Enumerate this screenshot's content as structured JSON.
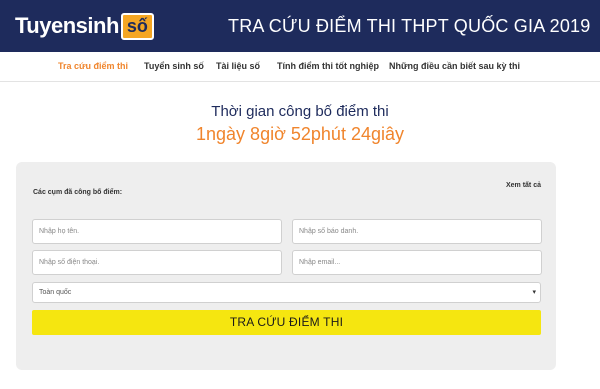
{
  "header": {
    "logo_text": "Tuyensinh",
    "logo_badge": "số",
    "title": "TRA CỨU ĐIỂM THI THPT QUỐC GIA 2019"
  },
  "nav": {
    "items": [
      {
        "label": "Tra cứu điểm thi",
        "active": true
      },
      {
        "label": "Tuyển sinh số",
        "active": false
      },
      {
        "label": "Tài liệu số",
        "active": false
      },
      {
        "label": "Tính điểm thi tốt nghiệp",
        "active": false
      },
      {
        "label": "Những điều cần biết sau kỳ thi",
        "active": false
      }
    ]
  },
  "countdown": {
    "label": "Thời gian công bố điểm thi",
    "value": "1ngày 8giờ 52phút 24giây"
  },
  "form": {
    "clusters_label": "Các cụm đã công bố điểm:",
    "see_all": "Xem tất cả",
    "name_placeholder": "Nhập họ tên.",
    "sbd_placeholder": "Nhập số báo danh.",
    "phone_placeholder": "Nhập số điện thoại.",
    "email_placeholder": "Nhập email...",
    "region_selected": "Toàn quốc",
    "submit_label": "TRA CỨU ĐIỂM THI"
  },
  "colors": {
    "header_bg": "#1e2b5c",
    "accent_orange": "#f0852d",
    "submit_yellow": "#f5e610",
    "panel_bg": "#eeeeee"
  }
}
